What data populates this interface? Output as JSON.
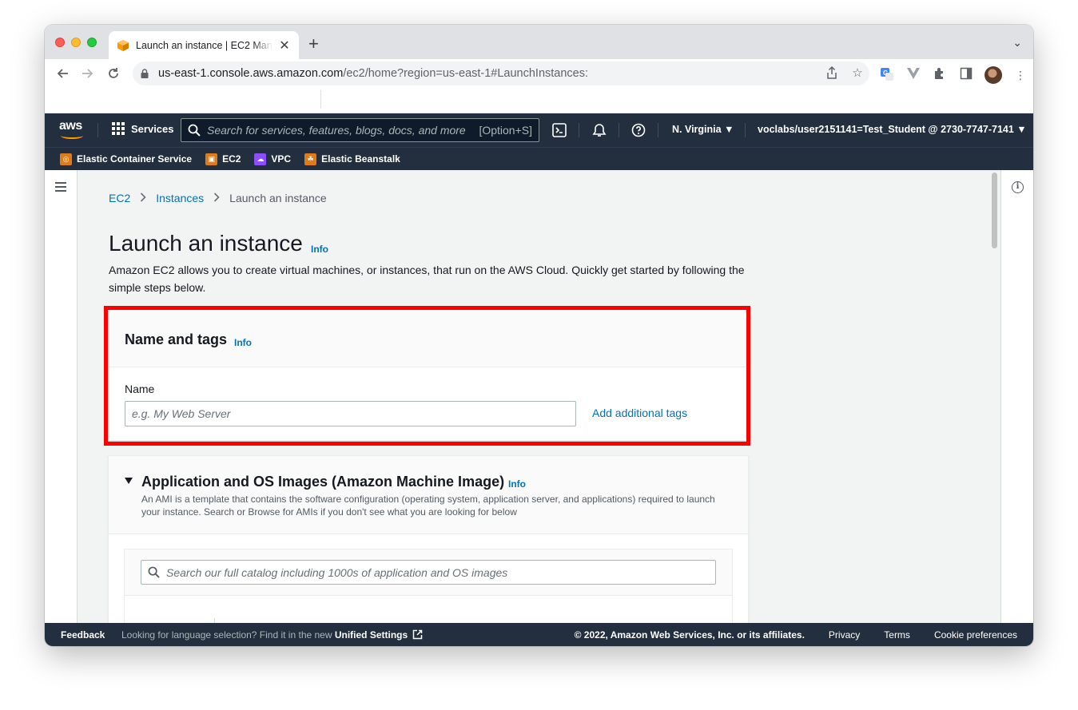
{
  "browser": {
    "tab_title": "Launch an instance | EC2 Management Console",
    "url_host": "us-east-1.console.aws.amazon.com",
    "url_path": "/ec2/home?region=us-east-1#LaunchInstances:"
  },
  "aws_nav": {
    "logo": "aws",
    "services_label": "Services",
    "search_placeholder": "Search for services, features, blogs, docs, and more",
    "search_shortcut": "[Option+S]",
    "region": "N. Virginia ▼",
    "account": "voclabs/user2151141=Test_Student @ 2730-7747-7141 ▼"
  },
  "favorites": [
    {
      "label": "Elastic Container Service",
      "color": "#e07b17"
    },
    {
      "label": "EC2",
      "color": "#e07b17"
    },
    {
      "label": "VPC",
      "color": "#8c4fff"
    },
    {
      "label": "Elastic Beanstalk",
      "color": "#e07b17"
    }
  ],
  "breadcrumb": {
    "ec2": "EC2",
    "instances": "Instances",
    "current": "Launch an instance"
  },
  "page": {
    "title": "Launch an instance",
    "info": "Info",
    "description": "Amazon EC2 allows you to create virtual machines, or instances, that run on the AWS Cloud. Quickly get started by following the simple steps below."
  },
  "name_tags": {
    "title": "Name and tags",
    "info": "Info",
    "field_label": "Name",
    "placeholder": "e.g. My Web Server",
    "add_tags": "Add additional tags"
  },
  "ami": {
    "title": "Application and OS Images (Amazon Machine Image)",
    "info": "Info",
    "description": "An AMI is a template that contains the software configuration (operating system, application server, and applications) required to launch your instance. Search or Browse for AMIs if you don't see what you are looking for below",
    "search_placeholder": "Search our full catalog including 1000s of application and OS images"
  },
  "footer": {
    "feedback": "Feedback",
    "language_text": "Looking for language selection? Find it in the new ",
    "unified_settings": "Unified Settings",
    "copyright": "© 2022, Amazon Web Services, Inc. or its affiliates.",
    "privacy": "Privacy",
    "terms": "Terms",
    "cookies": "Cookie preferences"
  },
  "colors": {
    "aws_header": "#232f3e",
    "link": "#0073bb",
    "highlight": "#ff0000",
    "aws_orange": "#ff9900"
  }
}
